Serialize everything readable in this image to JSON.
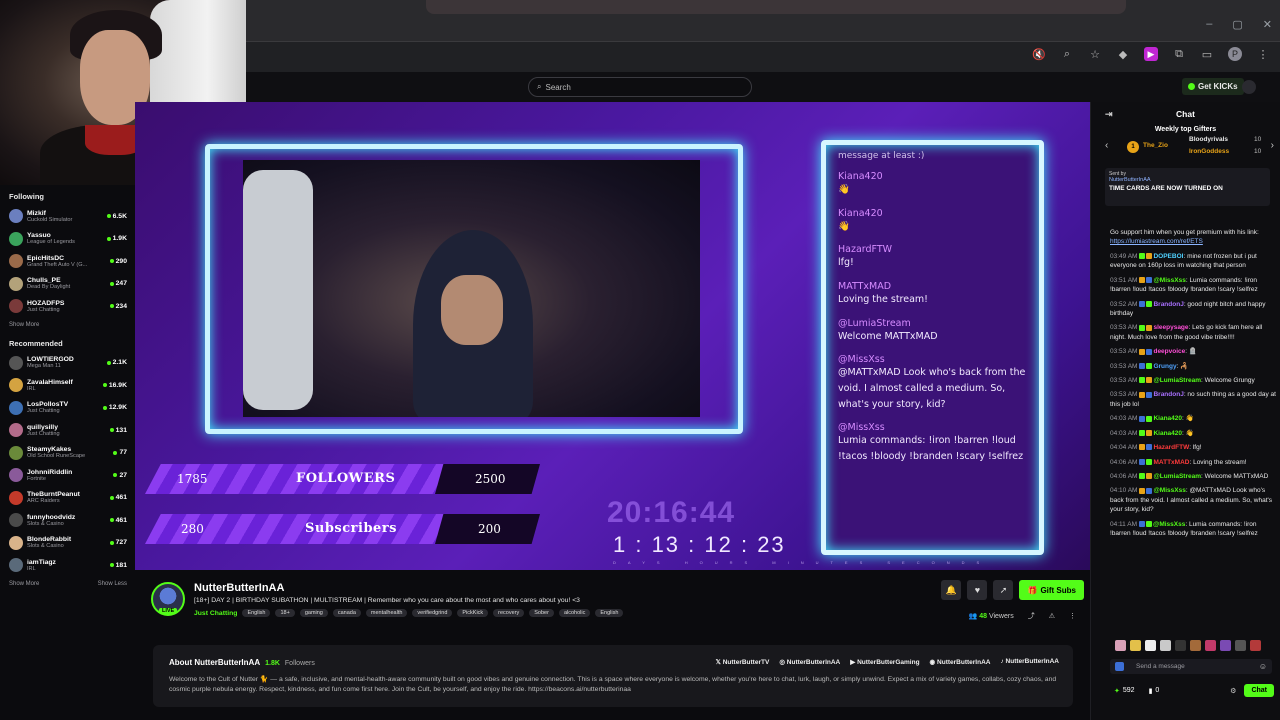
{
  "browser": {
    "window_controls": [
      "–",
      "▢",
      "✕"
    ],
    "toolbar_icons": [
      "mute-icon",
      "zoom-icon",
      "star-icon",
      "extension-diamond-icon",
      "extension-pink-icon",
      "puzzle-icon",
      "sidepanel-icon",
      "profile-avatar",
      "menu-icon"
    ],
    "profile_initial": "P"
  },
  "topbar": {
    "search_placeholder": "Search",
    "get_kicks": "Get KICKs"
  },
  "sidebar": {
    "following_title": "Following",
    "following": [
      {
        "name": "Mizkif",
        "category": "Cuckold Simulator",
        "viewers": "6.5K",
        "color": "#6b7fbf"
      },
      {
        "name": "Yassuo",
        "category": "League of Legends",
        "viewers": "1.9K",
        "color": "#3aa35c"
      },
      {
        "name": "EpicHitsDC",
        "category": "Grand Theft Auto V (G...",
        "viewers": "290",
        "color": "#9a6a4a"
      },
      {
        "name": "Chulls_PE",
        "category": "Dead By Daylight",
        "viewers": "247",
        "color": "#b3a27a"
      },
      {
        "name": "HOZADFPS",
        "category": "Just Chatting",
        "viewers": "234",
        "color": "#7a3a3a"
      }
    ],
    "show_more": "Show More",
    "recommended_title": "Recommended",
    "recommended": [
      {
        "name": "LOWTIERGOD",
        "category": "Mega Man 11",
        "viewers": "2.1K",
        "color": "#555"
      },
      {
        "name": "ZavalaHimself",
        "category": "IRL",
        "viewers": "16.9K",
        "color": "#d4a341"
      },
      {
        "name": "LosPollosTV",
        "category": "Just Chatting",
        "viewers": "12.9K",
        "color": "#3d6fb3"
      },
      {
        "name": "quillysilly",
        "category": "Just Chatting",
        "viewers": "131",
        "color": "#b36b8a"
      },
      {
        "name": "SteamyKakes",
        "category": "Old School RuneScape",
        "viewers": "77",
        "color": "#6a8a3a"
      },
      {
        "name": "JohnniRiddlin",
        "category": "Fortnite",
        "viewers": "27",
        "color": "#8a5a9a"
      },
      {
        "name": "TheBurntPeanut",
        "category": "ARC Raiders",
        "viewers": "461",
        "color": "#c43a2a"
      },
      {
        "name": "funnyhoodvidz",
        "category": "Slots & Casino",
        "viewers": "461",
        "color": "#4a4a4a"
      },
      {
        "name": "BlondeRabbit",
        "category": "Slots & Casino",
        "viewers": "727",
        "color": "#d9b38a"
      },
      {
        "name": "iamTiagz",
        "category": "IRL",
        "viewers": "181",
        "color": "#5a6a7a"
      }
    ],
    "show_more_2": "Show More",
    "show_less": "Show Less"
  },
  "overlay": {
    "chat_top": "message at least :)",
    "messages": [
      {
        "user": "Kiana420",
        "text": "👋"
      },
      {
        "user": "Kiana420",
        "text": "👋"
      },
      {
        "user": "HazardFTW",
        "text": "lfg!"
      },
      {
        "user": "MATTxMAD",
        "text": "Loving the stream!"
      },
      {
        "user": "@LumiaStream",
        "text": "Welcome MATTxMAD"
      },
      {
        "user": "@MissXss",
        "text": "@MATTxMAD Look who's back from the void. I almost called a medium. So, what's your story, kid?"
      },
      {
        "user": "@MissXss",
        "text": "Lumia commands: !iron !barren !loud !tacos !bloody !branden !scary !selfrez"
      }
    ],
    "followers_current": "1785",
    "followers_label": "FOLLOWERS",
    "followers_goal": "2500",
    "subs_current": "280",
    "subs_label": "Subscribers",
    "subs_goal": "200",
    "timer_large": "20:16:44",
    "timer": "1 : 13 : 12 : 23",
    "timer_units": "DAYS HOURS MINUTES SECONDS"
  },
  "stream": {
    "live_label": "LIVE",
    "streamer": "NutterButterInAA",
    "title": "[18+] DAY 2 | BIRTHDAY SUBATHON | MULTISTREAM | Remember who you care about the most and who cares about you! <3",
    "category": "Just Chatting",
    "tags": [
      "English",
      "18+",
      "gaming",
      "canada",
      "mentalhealth",
      "verifiedgrind",
      "PickKick",
      "recovery",
      "Sober",
      "alcoholic",
      "English"
    ],
    "gift_subs": "Gift Subs",
    "viewers_count": "48",
    "viewers_label": "Viewers"
  },
  "about": {
    "title": "About NutterButterInAA",
    "followers_count": "1.8K",
    "followers_label": "Followers",
    "socials": [
      "NutterButterTV",
      "NutterButterInAA",
      "NutterButterGaming",
      "NutterButterInAA",
      "NutterButterInAA"
    ],
    "text": "Welcome to the Cult of Nutter 🐈 — a safe, inclusive, and mental-health-aware community built on good vibes and genuine connection. This is a space where everyone is welcome, whether you're here to chat, lurk, laugh, or simply unwind. Expect a mix of variety games, collabs, cozy chaos, and cosmic purple nebula energy. Respect, kindness, and fun come first here. Join the Cult, be yourself, and enjoy the ride. https://beacons.ai/nutterbutterinaa"
  },
  "chat": {
    "title": "Chat",
    "gifters_title": "Weekly top Gifters",
    "gifters": [
      {
        "rank": "1",
        "name": "The_Zio",
        "count": "",
        "color": "#e8a317"
      },
      {
        "name": "Bloodyrivals",
        "count": "10",
        "color": "#e8e8e8"
      },
      {
        "name": "IronGoddess",
        "count": "10",
        "color": "#e8a317"
      }
    ],
    "pinned_by": "Sent by",
    "pinned_user": "NutterButterInAA",
    "pinned_text": "TIME CARDS ARE NOW TURNED ON",
    "messages": [
      {
        "time": "",
        "user": "",
        "ucolor": "#fff",
        "text": "Go support him when you get premium with his link: ",
        "link": "https://lumiastream.com/ref/ETS"
      },
      {
        "time": "03:49 AM",
        "user": "DOPEBOI",
        "ucolor": "#4fd1ff",
        "text": ": mine not frozen but i put everyone on 160p loss im watching that person"
      },
      {
        "time": "03:51 AM",
        "user": "@MissXss",
        "ucolor": "#53fc18",
        "text": ": Lumia commands: !iron !barren !loud !tacos !bloody !branden !scary !selfrez"
      },
      {
        "time": "03:52 AM",
        "user": "BrandonJ",
        "ucolor": "#a970ff",
        "text": ": good night bitch and happy birthday"
      },
      {
        "time": "03:53 AM",
        "user": "sleepysage",
        "ucolor": "#ff4fd8",
        "text": ": Lets go kick fam here all night. Much love from the good vibe tribe!!!!"
      },
      {
        "time": "03:53 AM",
        "user": "deepvoice",
        "ucolor": "#ff4fd8",
        "text": ": 🪦"
      },
      {
        "time": "03:53 AM",
        "user": "Grungy",
        "ucolor": "#4fa3ff",
        "text": ": 🦂"
      },
      {
        "time": "03:53 AM",
        "user": "@LumiaStream",
        "ucolor": "#53fc18",
        "text": ": Welcome Grungy"
      },
      {
        "time": "03:53 AM",
        "user": "BrandonJ",
        "ucolor": "#a970ff",
        "text": ": no such thing as a good day at this job lol"
      },
      {
        "time": "04:03 AM",
        "user": "Kiana420",
        "ucolor": "#53fc18",
        "text": ": 👋"
      },
      {
        "time": "04:03 AM",
        "user": "Kiana420",
        "ucolor": "#53fc18",
        "text": ": 👋"
      },
      {
        "time": "04:04 AM",
        "user": "HazardFTW",
        "ucolor": "#ff3b3b",
        "text": ": lfg!"
      },
      {
        "time": "04:06 AM",
        "user": "MATTxMAD",
        "ucolor": "#ff3b3b",
        "text": ": Loving the stream!"
      },
      {
        "time": "04:06 AM",
        "user": "@LumiaStream",
        "ucolor": "#53fc18",
        "text": ": Welcome MATTxMAD"
      },
      {
        "time": "04:10 AM",
        "user": "@MissXss",
        "ucolor": "#53fc18",
        "text": ": @MATTxMAD Look who's back from the void. I almost called a medium. So, what's your story, kid?"
      },
      {
        "time": "04:11 AM",
        "user": "@MissXss",
        "ucolor": "#53fc18",
        "text": ": Lumia commands: !iron !barren !loud !tacos !bloody !branden !scary !selfrez"
      }
    ],
    "input_placeholder": "Send a message",
    "points": "592",
    "extra_count": "0",
    "chat_button": "Chat"
  }
}
